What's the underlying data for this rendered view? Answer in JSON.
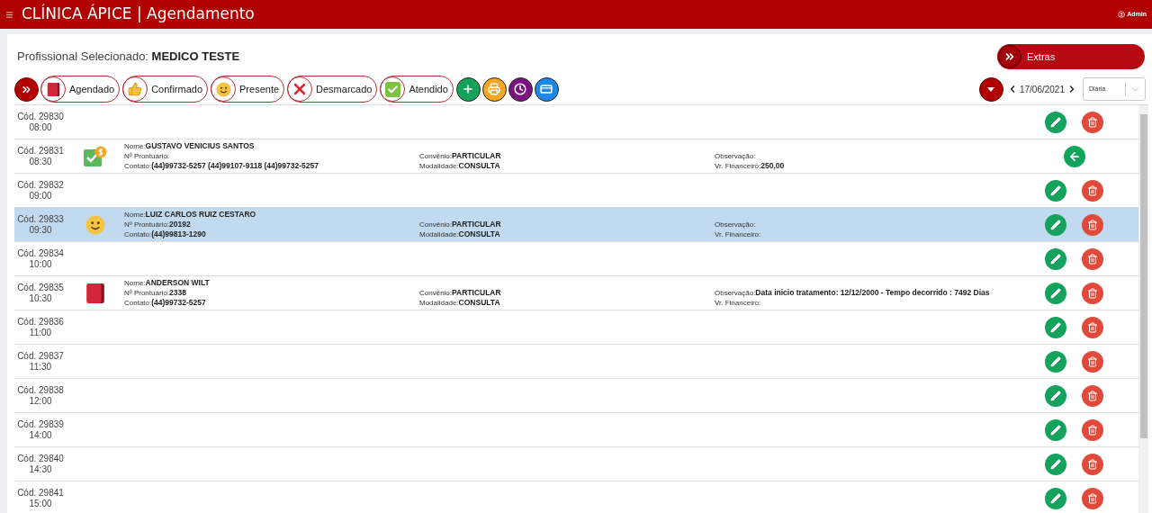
{
  "header": {
    "title": "CLÍNICA ÁPICE | Agendamento",
    "user": "Admin"
  },
  "professional": {
    "label": "Profissional Selecionado:",
    "name": "MEDICO TESTE"
  },
  "extras_button": "Extras",
  "status_filters": [
    {
      "kind": "scheduled",
      "label": "Agendado"
    },
    {
      "kind": "confirmed",
      "label": "Confirmado"
    },
    {
      "kind": "present",
      "label": "Presente"
    },
    {
      "kind": "cancelled",
      "label": "Desmarcado"
    },
    {
      "kind": "attended",
      "label": "Atendido"
    }
  ],
  "tool_buttons": [
    {
      "kind": "add"
    },
    {
      "kind": "print"
    },
    {
      "kind": "clock"
    },
    {
      "kind": "card"
    }
  ],
  "date": "17/06/2021",
  "view_select": {
    "value": "Diária"
  },
  "rows": [
    {
      "code": "Cód. 29830",
      "time": "08:00",
      "selected": false,
      "actions": [
        {
          "kind": "edit"
        },
        {
          "kind": "delete"
        }
      ]
    },
    {
      "code": "Cód. 29831",
      "time": "08:30",
      "selected": false,
      "status": {
        "kind": "paid"
      },
      "actions": [
        {
          "kind": "return"
        }
      ],
      "patient": {
        "left": [
          {
            "label": "Nome:",
            "value": "GUSTAVO VENICIUS SANTOS"
          },
          {
            "label": "Nº Prontuário:"
          },
          {
            "label": "Contato:",
            "value": "(44)99732-5257 (44)99107-9118 (44)99732-5257"
          }
        ],
        "middle": [
          {
            "label": "Convênio:",
            "value": "PARTICULAR"
          },
          {
            "label": "Modalidade:",
            "value": "CONSULTA"
          }
        ],
        "right": [
          {
            "label": "Observação:"
          },
          {
            "label": "Vr. Financeiro:",
            "value": "250,00"
          }
        ]
      }
    },
    {
      "code": "Cód. 29832",
      "time": "09:00",
      "selected": false,
      "actions": [
        {
          "kind": "edit"
        },
        {
          "kind": "delete"
        }
      ]
    },
    {
      "code": "Cód. 29833",
      "time": "09:30",
      "selected": true,
      "status": {
        "kind": "present"
      },
      "actions": [
        {
          "kind": "edit"
        },
        {
          "kind": "delete"
        }
      ],
      "patient": {
        "left": [
          {
            "label": "Nome:",
            "value": "LUIZ CARLOS RUIZ CESTARO"
          },
          {
            "label": "Nº Prontuário:",
            "value": "20192"
          },
          {
            "label": "Contato:",
            "value": "(44)99813-1290"
          }
        ],
        "middle": [
          {
            "label": "Convênio:",
            "value": "PARTICULAR"
          },
          {
            "label": "Modalidade:",
            "value": "CONSULTA"
          }
        ],
        "right": [
          {
            "label": "Observação:"
          },
          {
            "label": "Vr. Financeiro:"
          }
        ]
      }
    },
    {
      "code": "Cód. 29834",
      "time": "10:00",
      "selected": false,
      "actions": [
        {
          "kind": "edit"
        },
        {
          "kind": "delete"
        }
      ]
    },
    {
      "code": "Cód. 29835",
      "time": "10:30",
      "selected": false,
      "status": {
        "kind": "scheduled"
      },
      "actions": [
        {
          "kind": "edit"
        },
        {
          "kind": "delete"
        }
      ],
      "patient": {
        "left": [
          {
            "label": "Nome:",
            "value": "ANDERSON WILT"
          },
          {
            "label": "Nº Prontuário:",
            "value": "2338"
          },
          {
            "label": "Contato:",
            "value": "(44)99732-5257"
          }
        ],
        "middle": [
          {
            "label": "Convênio:",
            "value": "PARTICULAR"
          },
          {
            "label": "Modalidade:",
            "value": "CONSULTA"
          }
        ],
        "right": [
          {
            "label": "Observação:",
            "value": "Data inicio tratamento: 12/12/2000 - Tempo decorrido : 7492 Dias"
          },
          {
            "label": "Vr. Financeiro:"
          }
        ]
      }
    },
    {
      "code": "Cód. 29836",
      "time": "11:00",
      "selected": false,
      "actions": [
        {
          "kind": "edit"
        },
        {
          "kind": "delete"
        }
      ]
    },
    {
      "code": "Cód. 29837",
      "time": "11:30",
      "selected": false,
      "actions": [
        {
          "kind": "edit"
        },
        {
          "kind": "delete"
        }
      ]
    },
    {
      "code": "Cód. 29838",
      "time": "12:00",
      "selected": false,
      "actions": [
        {
          "kind": "edit"
        },
        {
          "kind": "delete"
        }
      ]
    },
    {
      "code": "Cód. 29839",
      "time": "14:00",
      "selected": false,
      "actions": [
        {
          "kind": "edit"
        },
        {
          "kind": "delete"
        }
      ]
    },
    {
      "code": "Cód. 29840",
      "time": "14:30",
      "selected": false,
      "actions": [
        {
          "kind": "edit"
        },
        {
          "kind": "delete"
        }
      ]
    },
    {
      "code": "Cód. 29841",
      "time": "15:00",
      "selected": false,
      "actions": [
        {
          "kind": "edit"
        },
        {
          "kind": "delete"
        }
      ]
    }
  ]
}
